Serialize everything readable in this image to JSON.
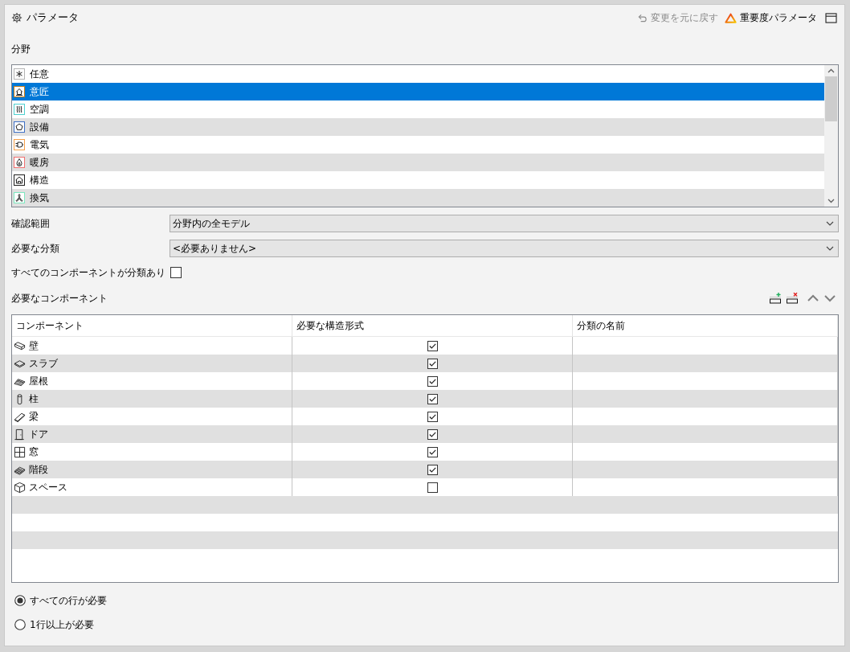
{
  "header": {
    "title": "パラメータ",
    "actions": [
      {
        "kind": "undo",
        "label": "変更を元に戻す",
        "disabled": true
      },
      {
        "kind": "severity",
        "label": "重要度パラメータ",
        "disabled": false
      }
    ]
  },
  "disciplines": {
    "label": "分野",
    "items": [
      {
        "label": "任意",
        "kind": "any",
        "color": "#b4b4b4",
        "selected": false
      },
      {
        "label": "意匠",
        "kind": "architecture",
        "color": "#c97d1a",
        "selected": true
      },
      {
        "label": "空調",
        "kind": "hvac",
        "color": "#4fd1d1",
        "selected": false
      },
      {
        "label": "設備",
        "kind": "equipment",
        "color": "#3d6fc4",
        "selected": false
      },
      {
        "label": "電気",
        "kind": "electrical",
        "color": "#f5a04a",
        "selected": false
      },
      {
        "label": "暖房",
        "kind": "heating",
        "color": "#f07070",
        "selected": false
      },
      {
        "label": "構造",
        "kind": "structure",
        "color": "#202020",
        "selected": false
      },
      {
        "label": "換気",
        "kind": "ventilation",
        "color": "#7de8c0",
        "selected": false
      }
    ]
  },
  "fields": [
    {
      "kind": "dropdown",
      "label": "確認範囲",
      "value": "分野内の全モデル"
    },
    {
      "kind": "dropdown",
      "label": "必要な分類",
      "value": "<必要ありません>"
    },
    {
      "kind": "checkbox",
      "label": "すべてのコンポーネントが分類あり",
      "checked": false
    }
  ],
  "components": {
    "label": "必要なコンポーネント",
    "columns": [
      "コンポーネント",
      "必要な構造形式",
      "分類の名前"
    ],
    "rows": [
      {
        "name": "壁",
        "kind": "wall",
        "checked": true
      },
      {
        "name": "スラブ",
        "kind": "slab",
        "checked": true
      },
      {
        "name": "屋根",
        "kind": "roof",
        "checked": true
      },
      {
        "name": "柱",
        "kind": "column",
        "checked": true
      },
      {
        "name": "梁",
        "kind": "beam",
        "checked": true
      },
      {
        "name": "ドア",
        "kind": "door",
        "checked": true
      },
      {
        "name": "窓",
        "kind": "window",
        "checked": true
      },
      {
        "name": "階段",
        "kind": "stairs",
        "checked": true
      },
      {
        "name": "スペース",
        "kind": "space",
        "checked": false
      }
    ]
  },
  "requirement": {
    "options": [
      {
        "label": "すべての行が必要",
        "selected": true
      },
      {
        "label": "1行以上が必要",
        "selected": false
      }
    ]
  }
}
